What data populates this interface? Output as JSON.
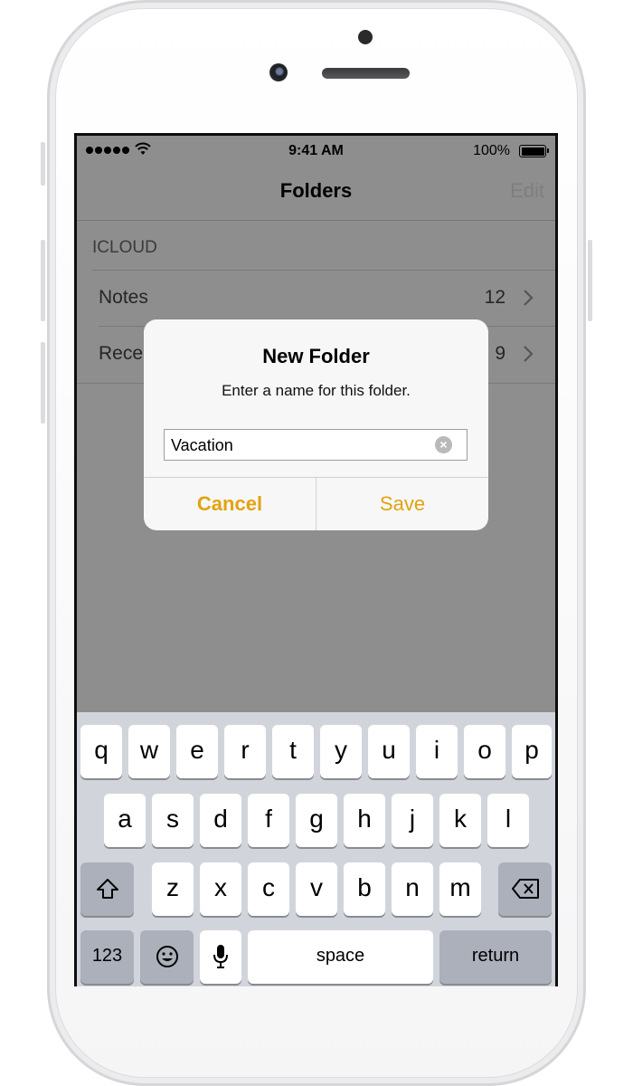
{
  "status_bar": {
    "time": "9:41 AM",
    "battery": "100%"
  },
  "nav": {
    "title": "Folders",
    "edit": "Edit"
  },
  "section": {
    "header": "ICLOUD"
  },
  "rows": [
    {
      "label": "Notes",
      "count": "12"
    },
    {
      "label": "Rece",
      "count": "9"
    }
  ],
  "alert": {
    "title": "New Folder",
    "message": "Enter a name for this folder.",
    "field_value": "Vacation",
    "cancel": "Cancel",
    "save": "Save"
  },
  "keyboard": {
    "row1": [
      "q",
      "w",
      "e",
      "r",
      "t",
      "y",
      "u",
      "i",
      "o",
      "p"
    ],
    "row2": [
      "a",
      "s",
      "d",
      "f",
      "g",
      "h",
      "j",
      "k",
      "l"
    ],
    "row3": [
      "z",
      "x",
      "c",
      "v",
      "b",
      "n",
      "m"
    ],
    "numbers": "123",
    "space": "space",
    "return": "return"
  },
  "colors": {
    "accent": "#E3A30E",
    "dim_background": "#8E8E8E",
    "keyboard": "#D1D5DB"
  },
  "icons": [
    "signal-icon",
    "wifi-icon",
    "battery-icon",
    "chevron-right-icon",
    "clear-text-icon",
    "shift-icon",
    "delete-icon",
    "emoji-icon",
    "microphone-icon"
  ]
}
